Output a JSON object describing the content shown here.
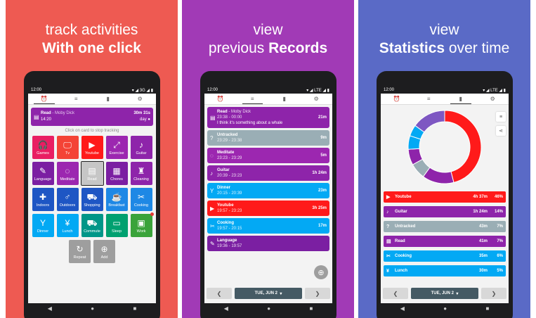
{
  "colors": {
    "purple": "#8e24aa",
    "red": "#ff1a1a",
    "blue": "#03a9f4",
    "teal": "#009688",
    "gray": "#9aaeb5",
    "green": "#3aa33a",
    "orange": "#ff9800",
    "indigo": "#3f51b5",
    "darkblue": "#1e56c4"
  },
  "panel1": {
    "caption1": "track activities",
    "caption2": "With one click",
    "status": {
      "time": "12:00",
      "net": "▾ ◢ 3G ◢ ▮"
    },
    "current": {
      "icon": "book-icon",
      "name": "Read",
      "sep": " - ",
      "note": "Moby Dick",
      "start": "14:20",
      "duration": "30m 31s",
      "day": "day"
    },
    "hint": "Click on card to stop tracking",
    "tiles": [
      {
        "label": "Games",
        "glyph": "🎧",
        "color": "#e91e63"
      },
      {
        "label": "Tv",
        "glyph": "🖵",
        "color": "#f44336"
      },
      {
        "label": "Youtube",
        "glyph": "▶",
        "color": "#ff1a1a"
      },
      {
        "label": "Exercise",
        "glyph": "⤢",
        "color": "#9c27b0"
      },
      {
        "label": "Guitar",
        "glyph": "♪",
        "color": "#8e24aa"
      },
      {
        "label": "Language",
        "glyph": "✎",
        "color": "#7b1fa2"
      },
      {
        "label": "Meditate",
        "glyph": "◌",
        "color": "#9c27b0"
      },
      {
        "label": "Read",
        "glyph": "▤",
        "color": "#c6c6c6"
      },
      {
        "label": "Chores",
        "glyph": "▦",
        "color": "#7b1fa2"
      },
      {
        "label": "Cleaning",
        "glyph": "♜",
        "color": "#8e24aa"
      },
      {
        "label": "Indoors",
        "glyph": "✚",
        "color": "#1e56c4"
      },
      {
        "label": "Outdoors",
        "glyph": "♂",
        "color": "#1e56c4"
      },
      {
        "label": "Shopping",
        "glyph": "⛟",
        "color": "#1e56c4"
      },
      {
        "label": "Breakfast",
        "glyph": "☕",
        "color": "#1e88e5"
      },
      {
        "label": "Cooking",
        "glyph": "✂",
        "color": "#1e88e5"
      },
      {
        "label": "Dinner",
        "glyph": "Y",
        "color": "#03a9f4"
      },
      {
        "label": "Lunch",
        "glyph": "¥",
        "color": "#03a9f4"
      },
      {
        "label": "Commute",
        "glyph": "⛟",
        "color": "#009688"
      },
      {
        "label": "Sleep",
        "glyph": "▭",
        "color": "#00a070"
      },
      {
        "label": "Work",
        "glyph": "▣",
        "color": "#3aa33a"
      }
    ],
    "actions": [
      {
        "label": "Repeat",
        "glyph": "↻"
      },
      {
        "label": "Add",
        "glyph": "⊕"
      }
    ]
  },
  "panel2": {
    "caption1": "view",
    "caption2a": "previous ",
    "caption2b": "Records",
    "status": {
      "time": "12:00",
      "net": "▾ ◢ LTE ◢ ▮"
    },
    "records": [
      {
        "name": "Read",
        "note": " - Moby Dick",
        "time": "23:38 - 00:00",
        "extra": "I think it's something about a whale",
        "dur": "21m",
        "color": "#8e24aa",
        "glyph": "▤"
      },
      {
        "name": "Untracked",
        "note": "",
        "time": "23:29 - 23:38",
        "extra": "",
        "dur": "9m",
        "color": "#9aaeb5",
        "glyph": "?"
      },
      {
        "name": "Meditate",
        "note": "",
        "time": "23:23 - 23:29",
        "extra": "",
        "dur": "5m",
        "color": "#9c27b0",
        "glyph": "◌"
      },
      {
        "name": "Guitar",
        "note": "",
        "time": "20:39 - 23:23",
        "extra": "",
        "dur": "1h 24m",
        "color": "#8e24aa",
        "glyph": "♪"
      },
      {
        "name": "Dinner",
        "note": "",
        "time": "20:15 - 20:39",
        "extra": "",
        "dur": "23m",
        "color": "#03a9f4",
        "glyph": "Y"
      },
      {
        "name": "Youtube",
        "note": "",
        "time": "19:57 - 23:23",
        "extra": "",
        "dur": "3h 25m",
        "color": "#ff1a1a",
        "glyph": "▶"
      },
      {
        "name": "Cooking",
        "note": "",
        "time": "19:57 - 20:15",
        "extra": "",
        "dur": "17m",
        "color": "#03a9f4",
        "glyph": "✂"
      },
      {
        "name": "Language",
        "note": "",
        "time": "19:36 - 19:57",
        "extra": "",
        "dur": "",
        "color": "#7b1fa2",
        "glyph": "✎"
      }
    ],
    "date": "TUE, JUN 2"
  },
  "panel3": {
    "caption1": "view",
    "caption2a": "Statistics",
    "caption2b": " over time",
    "status": {
      "time": "12:00",
      "net": "▾ ◢ LTE ◢ ▮"
    },
    "stats": [
      {
        "name": "Youtube",
        "time": "4h 37m",
        "pct": "46%",
        "color": "#ff1a1a",
        "glyph": "▶"
      },
      {
        "name": "Guitar",
        "time": "1h 24m",
        "pct": "14%",
        "color": "#8e24aa",
        "glyph": "♪"
      },
      {
        "name": "Untracked",
        "time": "43m",
        "pct": "7%",
        "color": "#9aaeb5",
        "glyph": "?"
      },
      {
        "name": "Read",
        "time": "41m",
        "pct": "7%",
        "color": "#8e24aa",
        "glyph": "▤"
      },
      {
        "name": "Cooking",
        "time": "35m",
        "pct": "6%",
        "color": "#03a9f4",
        "glyph": "✂"
      },
      {
        "name": "Lunch",
        "time": "30m",
        "pct": "5%",
        "color": "#03a9f4",
        "glyph": "¥"
      }
    ],
    "date": "TUE, JUN 2"
  }
}
